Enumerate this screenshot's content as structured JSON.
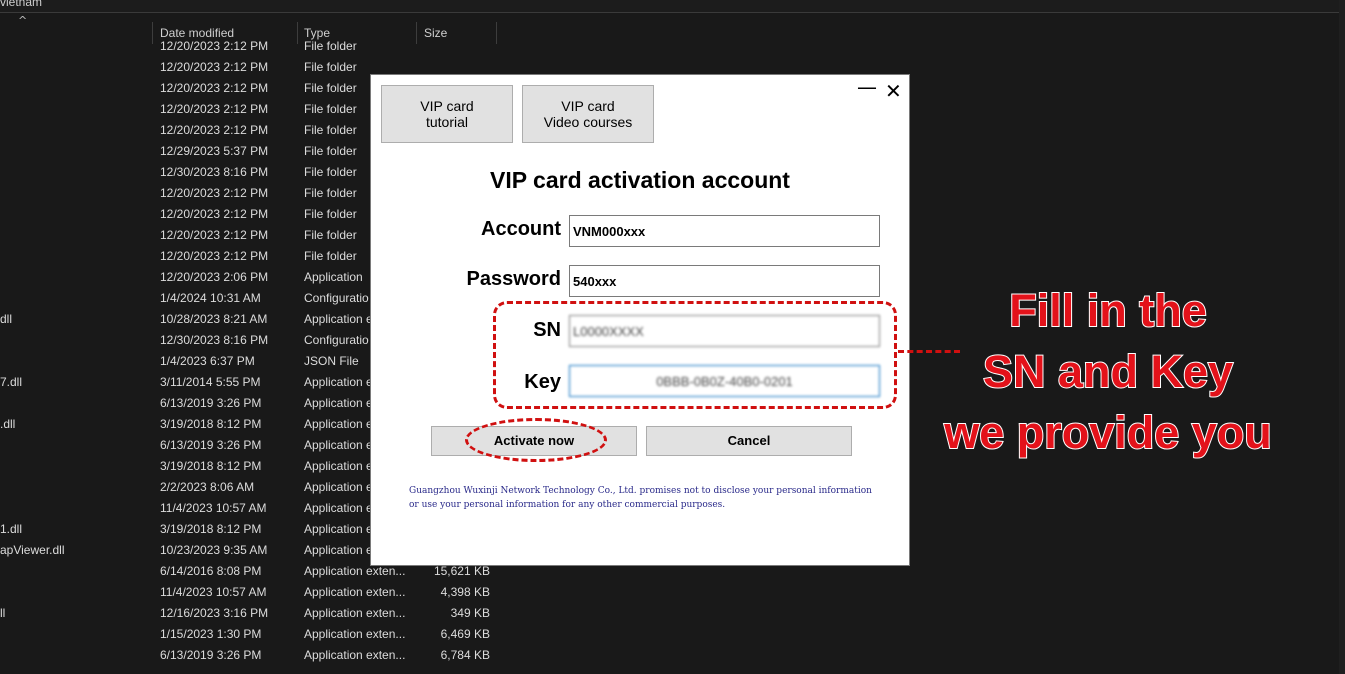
{
  "explorer": {
    "path_fragment": "vietnam",
    "columns": {
      "date": "Date modified",
      "type": "Type",
      "size": "Size"
    },
    "rows": [
      {
        "name": "",
        "date": "12/20/2023 2:12 PM",
        "type": "File folder",
        "size": ""
      },
      {
        "name": "",
        "date": "12/20/2023 2:12 PM",
        "type": "File folder",
        "size": ""
      },
      {
        "name": "",
        "date": "12/20/2023 2:12 PM",
        "type": "File folder",
        "size": ""
      },
      {
        "name": "",
        "date": "12/20/2023 2:12 PM",
        "type": "File folder",
        "size": ""
      },
      {
        "name": "",
        "date": "12/20/2023 2:12 PM",
        "type": "File folder",
        "size": ""
      },
      {
        "name": "",
        "date": "12/29/2023 5:37 PM",
        "type": "File folder",
        "size": ""
      },
      {
        "name": "",
        "date": "12/30/2023 8:16 PM",
        "type": "File folder",
        "size": ""
      },
      {
        "name": "",
        "date": "12/20/2023 2:12 PM",
        "type": "File folder",
        "size": ""
      },
      {
        "name": "",
        "date": "12/20/2023 2:12 PM",
        "type": "File folder",
        "size": ""
      },
      {
        "name": "",
        "date": "12/20/2023 2:12 PM",
        "type": "File folder",
        "size": ""
      },
      {
        "name": "",
        "date": "12/20/2023 2:12 PM",
        "type": "File folder",
        "size": ""
      },
      {
        "name": "",
        "date": "12/20/2023 2:06 PM",
        "type": "Application",
        "size": ""
      },
      {
        "name": "",
        "date": "1/4/2024 10:31 AM",
        "type": "Configuratio",
        "size": ""
      },
      {
        "name": "dll",
        "date": "10/28/2023 8:21 AM",
        "type": "Application e",
        "size": ""
      },
      {
        "name": "",
        "date": "12/30/2023 8:16 PM",
        "type": "Configuratio",
        "size": ""
      },
      {
        "name": "",
        "date": "1/4/2023 6:37 PM",
        "type": "JSON File",
        "size": ""
      },
      {
        "name": "7.dll",
        "date": "3/11/2014 5:55 PM",
        "type": "Application e",
        "size": ""
      },
      {
        "name": "",
        "date": "6/13/2019 3:26 PM",
        "type": "Application e",
        "size": ""
      },
      {
        "name": ".dll",
        "date": "3/19/2018 8:12 PM",
        "type": "Application e",
        "size": ""
      },
      {
        "name": "",
        "date": "6/13/2019 3:26 PM",
        "type": "Application e",
        "size": ""
      },
      {
        "name": "",
        "date": "3/19/2018 8:12 PM",
        "type": "Application e",
        "size": ""
      },
      {
        "name": "",
        "date": "2/2/2023 8:06 AM",
        "type": "Application e",
        "size": ""
      },
      {
        "name": "",
        "date": "11/4/2023 10:57 AM",
        "type": "Application e",
        "size": ""
      },
      {
        "name": "1.dll",
        "date": "3/19/2018 8:12 PM",
        "type": "Application e",
        "size": ""
      },
      {
        "name": "apViewer.dll",
        "date": "10/23/2023 9:35 AM",
        "type": "Application e",
        "size": ""
      },
      {
        "name": "",
        "date": "6/14/2016 8:08 PM",
        "type": "Application exten...",
        "size": "15,621 KB"
      },
      {
        "name": "",
        "date": "11/4/2023 10:57 AM",
        "type": "Application exten...",
        "size": "4,398 KB"
      },
      {
        "name": "ll",
        "date": "12/16/2023 3:16 PM",
        "type": "Application exten...",
        "size": "349 KB"
      },
      {
        "name": "",
        "date": "1/15/2023 1:30 PM",
        "type": "Application exten...",
        "size": "6,469 KB"
      },
      {
        "name": "",
        "date": "6/13/2019 3:26 PM",
        "type": "Application exten...",
        "size": "6,784 KB"
      }
    ]
  },
  "dialog": {
    "tabs": {
      "tutorial_line1": "VIP card",
      "tutorial_line2": "tutorial",
      "video_line1": "VIP card",
      "video_line2": "Video courses"
    },
    "window_controls": {
      "minimize": "—",
      "close": "✕"
    },
    "title": "VIP card activation account",
    "fields": {
      "account_label": "Account",
      "account_value": "VNM000xxx",
      "password_label": "Password",
      "password_value": "540xxx",
      "sn_label": "SN",
      "sn_value": "L0000XXXX",
      "key_label": "Key",
      "key_value": "0BBB-0B0Z-40B0-0201"
    },
    "buttons": {
      "activate": "Activate now",
      "cancel": "Cancel"
    },
    "disclaimer": "Guangzhou Wuxinji Network Technology Co., Ltd. promises not to disclose your personal information or use your personal information for any other commercial purposes."
  },
  "annotation": {
    "line1": "Fill in the",
    "line2": "SN and Key",
    "line3": "we provide you",
    "color": "#e3121a"
  }
}
